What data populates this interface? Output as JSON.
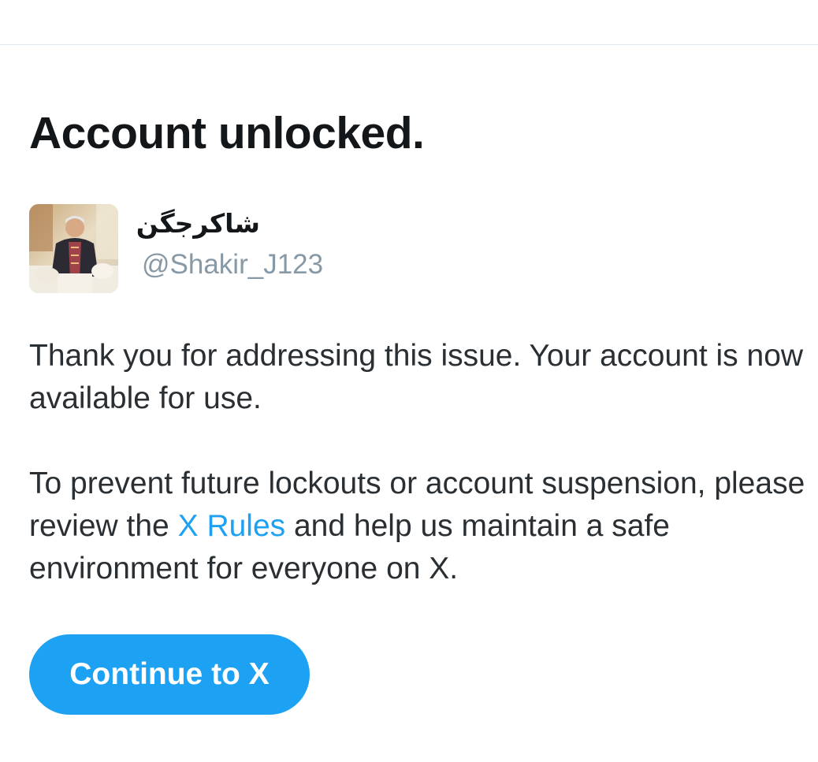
{
  "page": {
    "title": "Account unlocked."
  },
  "account": {
    "display_name": "شاکرجگن",
    "handle": "@Shakir_J123",
    "avatar": "profile-photo"
  },
  "message": {
    "para1": "Thank you for addressing this issue. Your account is now available for use.",
    "para2_before_link": "To prevent future lockouts or account suspension, please review the ",
    "para2_link": "X Rules",
    "para2_after_link": " and help us maintain a safe environment for everyone on X."
  },
  "actions": {
    "continue_label": "Continue to X"
  },
  "colors": {
    "accent": "#1da1f2",
    "text_primary": "#14171a",
    "text_secondary": "#8899a6",
    "divider": "#e1e8ed"
  }
}
